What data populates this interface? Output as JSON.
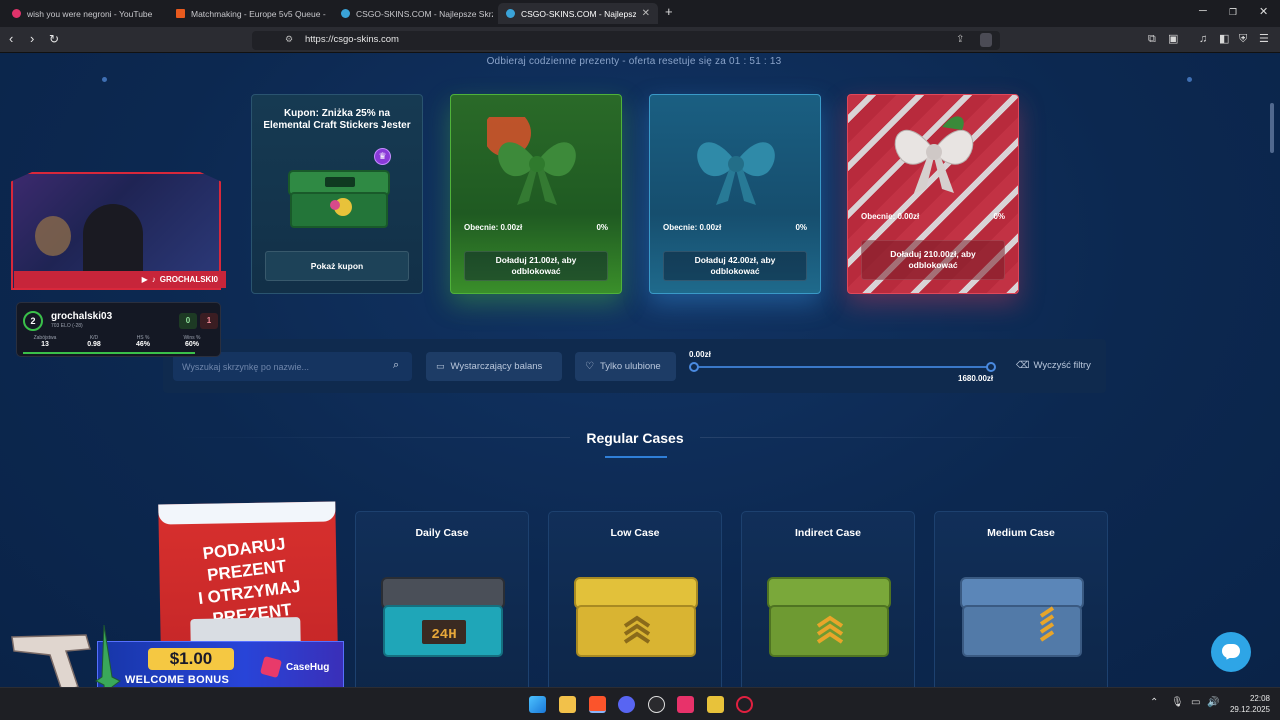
{
  "browser": {
    "tabs": [
      {
        "title": "wish you were negroni - YouTube",
        "color": "#e0336b"
      },
      {
        "title": "Matchmaking - Europe 5v5 Queue -",
        "color": "#e85a1e"
      },
      {
        "title": "CSGO-SKINS.COM - Najlepsze Skrzy",
        "color": "#3aa3d8"
      },
      {
        "title": "CSGO-SKINS.COM - Najlepsze Sk",
        "color": "#3aa3d8"
      }
    ],
    "new_tab": "+",
    "url": "https://csgo-skins.com"
  },
  "page": {
    "daily_rewards_text": "Odbieraj codzienne prezenty - oferta resetuje się za 01 : 51 : 13",
    "gifts": [
      {
        "type": "coupon",
        "title": "Kupon: Zniżka 25% na Elemental Craft Stickers Jester",
        "button": "Pokaż kupon"
      },
      {
        "type": "locked",
        "current": "Obecnie: 0.00zł",
        "percent": "0%",
        "button": "Doładuj 21.00zł, aby odblokować",
        "color": "#2c7a2b"
      },
      {
        "type": "locked",
        "current": "Obecnie: 0.00zł",
        "percent": "0%",
        "button": "Doładuj 42.00zł, aby odblokować",
        "color": "#1b6a8a"
      },
      {
        "type": "locked",
        "current": "Obecnie: 0.00zł",
        "percent": "0%",
        "button": "Doładuj 210.00zł, aby odblokować",
        "color": "#b22a3a"
      }
    ],
    "filters": {
      "search_placeholder": "Wyszukaj skrzynkę po nazwie...",
      "balance_button": "Wystarczający balans",
      "favorites_button": "Tylko ulubione",
      "range_min": "0.00zł",
      "range_max": "1680.00zł",
      "clear_button": "Wyczyść filtry"
    },
    "section_title": "Regular Cases",
    "promo": {
      "line1": "PODARUJ PREZENT",
      "line2": "I OTRZYMAJ PREZENT"
    },
    "cases": [
      {
        "name": "Daily Case",
        "label": "24H",
        "color": "#1fa6b8"
      },
      {
        "name": "Low Case",
        "label": "",
        "color": "#e2c13a"
      },
      {
        "name": "Indirect Case",
        "label": "",
        "color": "#7aa83a"
      },
      {
        "name": "Medium Case",
        "label": "",
        "color": "#5b86b8"
      }
    ]
  },
  "stream_overlay": {
    "handle": "GROCHALSKI0",
    "player": {
      "level": "2",
      "name": "grochalski03",
      "elo": "703 ELO (-28)",
      "score_left": "0",
      "score_right": "1",
      "stats": [
        {
          "label": "Zabójstwa",
          "value": "13"
        },
        {
          "label": "K/D",
          "value": "0.98"
        },
        {
          "label": "HS %",
          "value": "46%"
        },
        {
          "label": "Wins %",
          "value": "60%"
        }
      ]
    },
    "bonus": {
      "amount": "$1.00",
      "text": "WELCOME BONUS",
      "brand": "CaseHug"
    }
  },
  "taskbar": {
    "time": "22:08",
    "date": "29.12.2025"
  }
}
